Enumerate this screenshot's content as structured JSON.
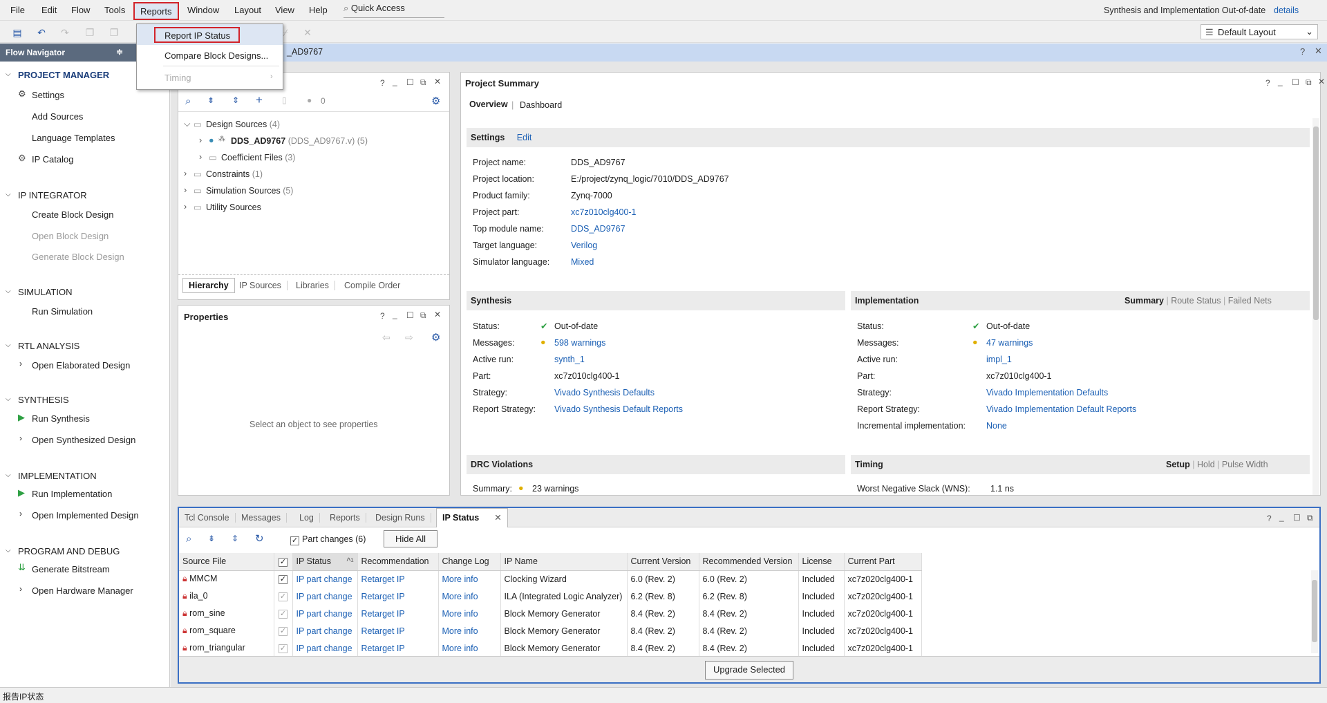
{
  "menu": {
    "items": [
      "File",
      "Edit",
      "Flow",
      "Tools",
      "Reports",
      "Window",
      "Layout",
      "View",
      "Help"
    ],
    "quick_access": "Quick Access",
    "status_text": "Synthesis and Implementation Out-of-date",
    "details_link": "details"
  },
  "reports_menu": {
    "items": [
      "Report IP Status",
      "Compare Block Designs...",
      "Timing"
    ]
  },
  "toolbar": {
    "layout_select": "Default Layout"
  },
  "flow_navigator": {
    "title": "Flow Navigator",
    "project_manager": {
      "label": "PROJECT MANAGER",
      "items": [
        "Settings",
        "Add Sources",
        "Language Templates",
        "IP Catalog"
      ]
    },
    "ip_integrator": {
      "label": "IP INTEGRATOR",
      "items": [
        "Create Block Design",
        "Open Block Design",
        "Generate Block Design"
      ]
    },
    "simulation": {
      "label": "SIMULATION",
      "items": [
        "Run Simulation"
      ]
    },
    "rtl_analysis": {
      "label": "RTL ANALYSIS",
      "items": [
        "Open Elaborated Design"
      ]
    },
    "synthesis": {
      "label": "SYNTHESIS",
      "items": [
        "Run Synthesis",
        "Open Synthesized Design"
      ]
    },
    "implementation": {
      "label": "IMPLEMENTATION",
      "items": [
        "Run Implementation",
        "Open Implemented Design"
      ]
    },
    "program_debug": {
      "label": "PROGRAM AND DEBUG",
      "items": [
        "Generate Bitstream",
        "Open Hardware Manager"
      ]
    }
  },
  "header": {
    "title_fragment": "AD9767"
  },
  "sources": {
    "error_count": "0",
    "tree": [
      {
        "label": "Design Sources",
        "count": "(4)"
      },
      {
        "label": "DDS_AD9767",
        "detail": "(DDS_AD9767.v) (5)"
      },
      {
        "label": "Coefficient Files",
        "count": "(3)"
      },
      {
        "label": "Constraints",
        "count": "(1)"
      },
      {
        "label": "Simulation Sources",
        "count": "(5)"
      },
      {
        "label": "Utility Sources",
        "count": ""
      }
    ],
    "tabs": [
      "Hierarchy",
      "IP Sources",
      "Libraries",
      "Compile Order"
    ]
  },
  "properties": {
    "title": "Properties",
    "empty": "Select an object to see properties"
  },
  "summary": {
    "title": "Project Summary",
    "tabs": [
      "Overview",
      "Dashboard"
    ],
    "settings": {
      "heading": "Settings",
      "edit": "Edit",
      "rows": [
        [
          "Project name:",
          "DDS_AD9767"
        ],
        [
          "Project location:",
          "E:/project/zynq_logic/7010/DDS_AD9767"
        ],
        [
          "Product family:",
          "Zynq-7000"
        ],
        [
          "Project part:",
          "xc7z010clg400-1"
        ],
        [
          "Top module name:",
          "DDS_AD9767"
        ],
        [
          "Target language:",
          "Verilog"
        ],
        [
          "Simulator language:",
          "Mixed"
        ]
      ]
    },
    "synthesis": {
      "heading": "Synthesis",
      "rows": [
        [
          "Status:",
          "Out-of-date"
        ],
        [
          "Messages:",
          "598 warnings"
        ],
        [
          "Active run:",
          "synth_1"
        ],
        [
          "Part:",
          "xc7z010clg400-1"
        ],
        [
          "Strategy:",
          "Vivado Synthesis Defaults"
        ],
        [
          "Report Strategy:",
          "Vivado Synthesis Default Reports"
        ]
      ]
    },
    "implementation": {
      "heading": "Implementation",
      "links": [
        "Summary",
        "Route Status",
        "Failed Nets"
      ],
      "rows": [
        [
          "Status:",
          "Out-of-date"
        ],
        [
          "Messages:",
          "47 warnings"
        ],
        [
          "Active run:",
          "impl_1"
        ],
        [
          "Part:",
          "xc7z010clg400-1"
        ],
        [
          "Strategy:",
          "Vivado Implementation Defaults"
        ],
        [
          "Report Strategy:",
          "Vivado Implementation Default Reports"
        ],
        [
          "Incremental implementation:",
          "None"
        ]
      ]
    },
    "drc": {
      "heading": "DRC Violations",
      "label": "Summary:",
      "value": "23 warnings"
    },
    "timing": {
      "heading": "Timing",
      "links": [
        "Setup",
        "Hold",
        "Pulse Width"
      ],
      "label": "Worst Negative Slack (WNS):",
      "value": "1.1 ns"
    }
  },
  "bottom": {
    "tabs": [
      "Tcl Console",
      "Messages",
      "Log",
      "Reports",
      "Design Runs",
      "IP Status"
    ],
    "part_changes": "Part changes (6)",
    "hide_all": "Hide All",
    "columns": [
      "Source File",
      "",
      "IP Status",
      "Recommendation",
      "Change Log",
      "IP Name",
      "Current Version",
      "Recommended Version",
      "License",
      "Current Part"
    ],
    "rows": [
      [
        "MMCM",
        "IP part change",
        "Retarget IP",
        "More info",
        "Clocking Wizard",
        "6.0 (Rev. 2)",
        "6.0 (Rev. 2)",
        "Included",
        "xc7z020clg400-1"
      ],
      [
        "ila_0",
        "IP part change",
        "Retarget IP",
        "More info",
        "ILA (Integrated Logic Analyzer)",
        "6.2 (Rev. 8)",
        "6.2 (Rev. 8)",
        "Included",
        "xc7z020clg400-1"
      ],
      [
        "rom_sine",
        "IP part change",
        "Retarget IP",
        "More info",
        "Block Memory Generator",
        "8.4 (Rev. 2)",
        "8.4 (Rev. 2)",
        "Included",
        "xc7z020clg400-1"
      ],
      [
        "rom_square",
        "IP part change",
        "Retarget IP",
        "More info",
        "Block Memory Generator",
        "8.4 (Rev. 2)",
        "8.4 (Rev. 2)",
        "Included",
        "xc7z020clg400-1"
      ],
      [
        "rom_triangular",
        "IP part change",
        "Retarget IP",
        "More info",
        "Block Memory Generator",
        "8.4 (Rev. 2)",
        "8.4 (Rev. 2)",
        "Included",
        "xc7z020clg400-1"
      ]
    ],
    "upgrade": "Upgrade Selected"
  },
  "statusbar": {
    "text": "报告IP状态"
  }
}
